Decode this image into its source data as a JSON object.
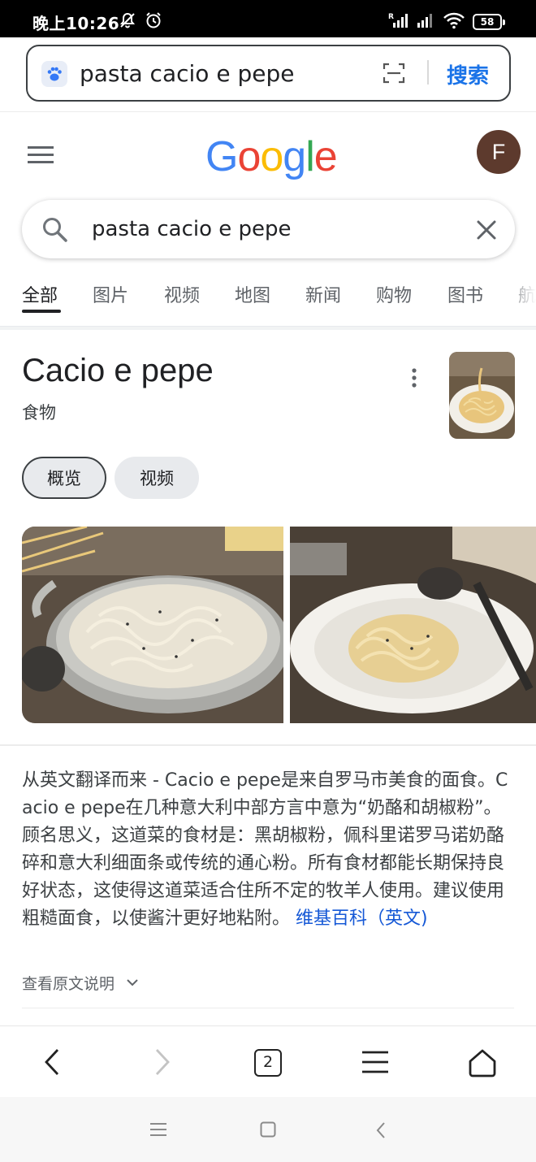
{
  "status_bar": {
    "time": "晚上10:26",
    "battery": "58",
    "icons": [
      "mute-bell-icon",
      "alarm-icon",
      "signal-roaming-icon",
      "signal-icon",
      "wifi-icon",
      "battery-icon"
    ]
  },
  "browser": {
    "site_icon": "paw-icon",
    "address_text": "pasta cacio e pepe",
    "scan_icon": "scan-icon",
    "search_button": "搜索"
  },
  "google": {
    "logo": "Google",
    "logo_colors": [
      "#4285F4",
      "#EA4335",
      "#FBBC05",
      "#4285F4",
      "#34A853",
      "#EA4335"
    ],
    "avatar_letter": "F",
    "avatar_color": "#5d3a2d"
  },
  "search": {
    "query": "pasta cacio e pepe"
  },
  "tabs": [
    {
      "label": "全部",
      "active": true
    },
    {
      "label": "图片"
    },
    {
      "label": "视频"
    },
    {
      "label": "地图"
    },
    {
      "label": "新闻"
    },
    {
      "label": "购物"
    },
    {
      "label": "图书"
    },
    {
      "label": "航"
    }
  ],
  "knowledge_panel": {
    "title": "Cacio e pepe",
    "subtitle": "食物",
    "chips": [
      "概览",
      "视频"
    ],
    "description": "从英文翻译而来 - Cacio e pepe是来自罗马市美食的面食。Cacio e pepe在几种意大利中部方言中意为“奶酪和胡椒粉”。顾名思义，这道菜的食材是：黑胡椒粉，佩科里诺罗马诺奶酪碎和意大利细面条或传统的通心粉。所有食材都能长期保持良好状态，这使得这道菜适合住所不定的牧羊人使用。建议使用粗糙面食，以使酱汁更好地粘附。",
    "source_link": "维基百科（英文)",
    "view_original": "查看原文说明"
  },
  "toolbar": {
    "tab_count": "2",
    "buttons": [
      "back-icon",
      "forward-icon",
      "tabs-icon",
      "menu-icon",
      "home-icon"
    ]
  },
  "system_nav": [
    "recents-icon",
    "home-icon",
    "back-icon"
  ]
}
